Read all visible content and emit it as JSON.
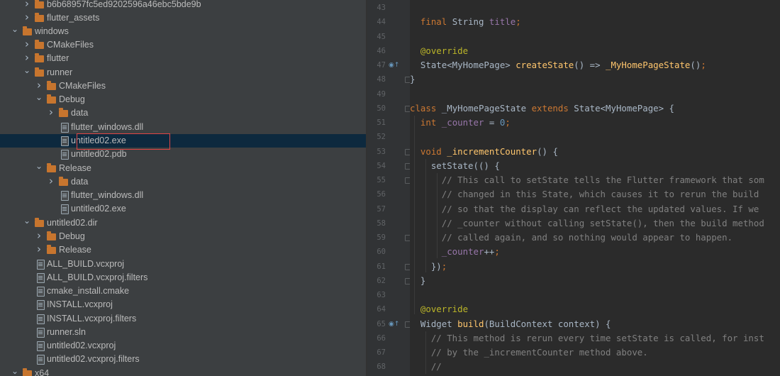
{
  "tree": {
    "items": [
      {
        "label": "b6b68957fc5ed9202596a46ebc5bde9b",
        "type": "folder",
        "state": "collapsed"
      },
      {
        "label": "flutter_assets",
        "type": "folder",
        "state": "collapsed"
      },
      {
        "label": "windows",
        "type": "folder",
        "state": "expanded"
      },
      {
        "label": "CMakeFiles",
        "type": "folder",
        "state": "collapsed"
      },
      {
        "label": "flutter",
        "type": "folder",
        "state": "collapsed"
      },
      {
        "label": "runner",
        "type": "folder",
        "state": "expanded"
      },
      {
        "label": "CMakeFiles",
        "type": "folder",
        "state": "collapsed"
      },
      {
        "label": "Debug",
        "type": "folder",
        "state": "expanded"
      },
      {
        "label": "data",
        "type": "folder",
        "state": "collapsed"
      },
      {
        "label": "flutter_windows.dll",
        "type": "file"
      },
      {
        "label": "untitled02.exe",
        "type": "file",
        "selected": true
      },
      {
        "label": "untitled02.pdb",
        "type": "file"
      },
      {
        "label": "Release",
        "type": "folder",
        "state": "expanded"
      },
      {
        "label": "data",
        "type": "folder",
        "state": "collapsed"
      },
      {
        "label": "flutter_windows.dll",
        "type": "file"
      },
      {
        "label": "untitled02.exe",
        "type": "file"
      },
      {
        "label": "untitled02.dir",
        "type": "folder",
        "state": "expanded"
      },
      {
        "label": "Debug",
        "type": "folder",
        "state": "collapsed"
      },
      {
        "label": "Release",
        "type": "folder",
        "state": "collapsed"
      },
      {
        "label": "ALL_BUILD.vcxproj",
        "type": "file"
      },
      {
        "label": "ALL_BUILD.vcxproj.filters",
        "type": "file"
      },
      {
        "label": "cmake_install.cmake",
        "type": "file"
      },
      {
        "label": "INSTALL.vcxproj",
        "type": "file"
      },
      {
        "label": "INSTALL.vcxproj.filters",
        "type": "file"
      },
      {
        "label": "runner.sln",
        "type": "file"
      },
      {
        "label": "untitled02.vcxproj",
        "type": "file"
      },
      {
        "label": "untitled02.vcxproj.filters",
        "type": "file"
      },
      {
        "label": "x64",
        "type": "folder",
        "state": "expanded"
      }
    ]
  },
  "editor": {
    "line_numbers": [
      "43",
      "44",
      "45",
      "46",
      "47",
      "48",
      "49",
      "50",
      "51",
      "52",
      "53",
      "54",
      "55",
      "56",
      "57",
      "58",
      "59",
      "60",
      "61",
      "62",
      "63",
      "64",
      "65",
      "66",
      "67",
      "68"
    ],
    "lines": [
      "",
      "  final String title;",
      "",
      "  @override",
      "  State<MyHomePage> createState() => _MyHomePageState();",
      "}",
      "",
      "class _MyHomePageState extends State<MyHomePage> {",
      "  int _counter = 0;",
      "",
      "  void _incrementCounter() {",
      "    setState(() {",
      "      // This call to setState tells the Flutter framework that som",
      "      // changed in this State, which causes it to rerun the build ",
      "      // so that the display can reflect the updated values. If we ",
      "      // _counter without calling setState(), then the build method",
      "      // called again, and so nothing would appear to happen.",
      "      _counter++;",
      "    });",
      "  }",
      "",
      "  @override",
      "  Widget build(BuildContext context) {",
      "    // This method is rerun every time setState is called, for inst",
      "    // by the _incrementCounter method above.",
      "    //"
    ]
  }
}
